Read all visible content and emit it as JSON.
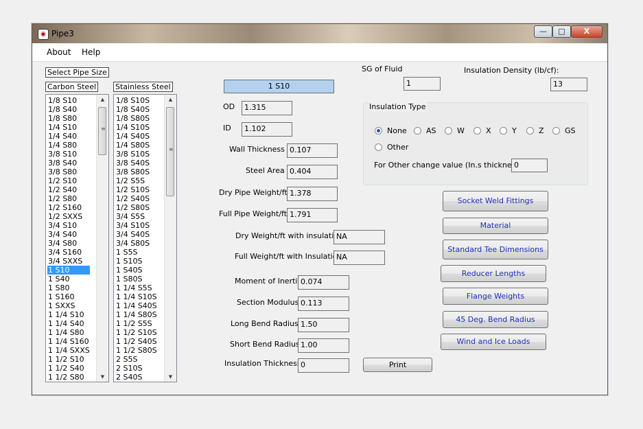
{
  "window": {
    "title": "Pipe3",
    "icon": "app-icon",
    "close_label": "X",
    "min_label": "—",
    "max_label": "□"
  },
  "menu": {
    "about": "About",
    "help": "Help"
  },
  "pipe_size": {
    "select_label": "Select Pipe Size",
    "carbon_label": "Carbon Steel",
    "stainless_label": "Stainless Steel",
    "carbon_items": [
      "1/8  S10",
      "1/8 S40",
      "1/8 S80",
      "1/4 S10",
      "1/4 S40",
      "1/4 S80",
      "3/8 S10",
      "3/8 S40",
      "3/8 S80",
      "1/2 S10",
      "1/2 S40",
      "1/2 S80",
      "1/2 S160",
      "1/2 SXXS",
      "3/4 S10",
      "3/4 S40",
      "3/4 S80",
      "3/4 S160",
      "3/4 SXXS",
      "1 S10",
      "1 S40",
      "1 S80",
      "1 S160",
      "1 SXXS",
      "1 1/4 S10",
      "1 1/4 S40",
      "1 1/4 S80",
      "1 1/4 S160",
      "1 1/4 SXXS",
      "1 1/2 S10",
      "1 1/2 S40",
      "1 1/2 S80"
    ],
    "carbon_selected": "1 S10",
    "stainless_items": [
      "1/8  S10S",
      "1/8 S40S",
      "1/8 S80S",
      "1/4 S10S",
      "1/4 S40S",
      "1/4 S80S",
      "3/8 S10S",
      "3/8 S40S",
      "3/8 S80S",
      "1/2 S5S",
      "1/2 S10S",
      "1/2 S40S",
      "1/2 S80S",
      "3/4 S5S",
      "3/4 S10S",
      "3/4 S40S",
      "3/4 S80S",
      "1 S5S",
      "1 S10S",
      "1 S40S",
      "1 S80S",
      "1 1/4 S5S",
      "1 1/4 S10S",
      "1 1/4 S40S",
      "1 1/4 S80S",
      "1 1/2 S5S",
      "1 1/2 S10S",
      "1 1/2 S40S",
      "1 1/2 S80S",
      "2 S5S",
      "2 S10S",
      "2 S40S"
    ]
  },
  "selected_pipe": "1 S10",
  "fields": {
    "od": {
      "label": "OD",
      "value": "1.315"
    },
    "id": {
      "label": "ID",
      "value": "1.102"
    },
    "wall": {
      "label": "Wall Thickness",
      "value": "0.107"
    },
    "steel_area": {
      "label": "Steel Area",
      "value": "0.404"
    },
    "dry_weight": {
      "label": "Dry Pipe Weight/ft",
      "value": "1.378"
    },
    "full_weight": {
      "label": "Full Pipe Weight/ft",
      "value": "1.791"
    },
    "dry_ins": {
      "label": "Dry Weight/ft with insulation",
      "value": "NA"
    },
    "full_ins": {
      "label": "Full Weight/ft with Insulation",
      "value": "NA"
    },
    "moment": {
      "label": "Moment of Inertia",
      "value": "0.074"
    },
    "section": {
      "label": "Section Modulus",
      "value": "0.113"
    },
    "long_bend": {
      "label": "Long Bend Radius",
      "value": "1.50"
    },
    "short_bend": {
      "label": "Short Bend Radius",
      "value": "1.00"
    },
    "ins_thick": {
      "label": "Insulation Thickness",
      "value": "0"
    }
  },
  "fluid": {
    "sg_label": "SG of Fluid",
    "sg_value": "1",
    "density_label": "Insulation Density (lb/cf):",
    "density_value": "13"
  },
  "insulation": {
    "group_label": "Insulation Type",
    "options": [
      "None",
      "AS",
      "W",
      "X",
      "Y",
      "Z",
      "GS"
    ],
    "other_label": "Other",
    "selected": "None",
    "other_change_label": "For Other change value (In.s thickness):",
    "other_change_value": "0"
  },
  "buttons": {
    "socket": "Socket Weld Fittings",
    "material": "Material",
    "tee": "Standard Tee Dimensions",
    "reducer": "Reducer Lengths",
    "flange": "Flange Weights",
    "bend45": "45 Deg. Bend Radius",
    "wind": "Wind and Ice Loads",
    "print": "Print"
  }
}
